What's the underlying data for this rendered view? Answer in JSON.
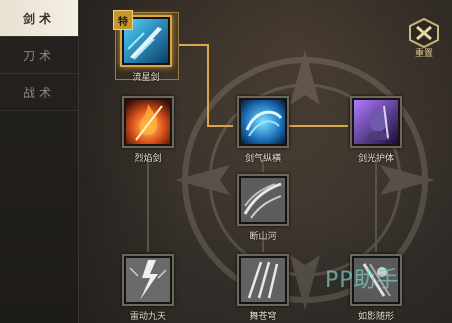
{
  "sidebar": {
    "tabs": [
      {
        "label": "剑术",
        "active": true
      },
      {
        "label": "刀术",
        "active": false
      },
      {
        "label": "战术",
        "active": false
      }
    ]
  },
  "toolbar": {
    "reset_label": "重置",
    "reset_icon": "reset-cross-icon"
  },
  "skills": {
    "meteor": {
      "label": "流星剑",
      "badge": "特",
      "icon": "meteor-sword-icon",
      "selected": true
    },
    "flame": {
      "label": "烈焰剑",
      "icon": "flame-sword-icon"
    },
    "qi": {
      "label": "剑气纵横",
      "icon": "sword-qi-icon"
    },
    "guard": {
      "label": "剑光护体",
      "icon": "sword-guard-icon"
    },
    "mountain": {
      "label": "断山河",
      "icon": "mountain-break-icon"
    },
    "thunder": {
      "label": "雷动九天",
      "icon": "thunder-icon"
    },
    "dance": {
      "label": "舞苍穹",
      "icon": "sky-dance-icon"
    },
    "shadow": {
      "label": "如影随形",
      "icon": "shadow-follow-icon"
    }
  },
  "watermark": "PP助手",
  "colors": {
    "accent": "#d9a64a",
    "active_tab_bg": "#f0eadc",
    "line_inactive": "#5a5349"
  }
}
